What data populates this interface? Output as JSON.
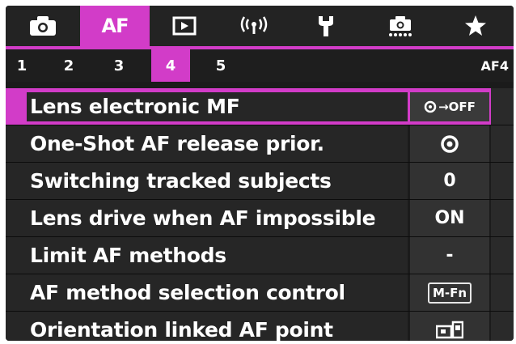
{
  "tabs": [
    {
      "icon": "camera-icon",
      "active": false
    },
    {
      "label": "AF",
      "active": true
    },
    {
      "icon": "playback-icon",
      "active": false
    },
    {
      "icon": "wireless-icon",
      "active": false
    },
    {
      "icon": "wrench-icon",
      "active": false
    },
    {
      "icon": "custom-function-icon",
      "active": false
    },
    {
      "icon": "star-icon",
      "active": false
    }
  ],
  "subtabs": {
    "items": [
      "1",
      "2",
      "3",
      "4",
      "5"
    ],
    "active_index": 3,
    "page_code": "AF4"
  },
  "menu": [
    {
      "label": "Lens electronic MF",
      "value": "→OFF",
      "value_icon": "focus-ring-icon",
      "selected": true
    },
    {
      "label": "One-Shot AF release prior.",
      "value_icon": "focus-priority-icon",
      "selected": false
    },
    {
      "label": "Switching tracked subjects",
      "value": "0",
      "selected": false
    },
    {
      "label": "Lens drive when AF impossible",
      "value": "ON",
      "selected": false
    },
    {
      "label": "Limit AF methods",
      "value": "-",
      "selected": false
    },
    {
      "label": "AF method selection control",
      "value": "M-Fn",
      "selected": false
    },
    {
      "label": "Orientation linked AF point",
      "value_icon": "orientation-linked-icon",
      "selected": false
    }
  ],
  "colors": {
    "accent": "#d23cc8",
    "background": "#1b1b1b",
    "row": "#262626",
    "value_cell": "#323232",
    "text": "#ffffff"
  }
}
